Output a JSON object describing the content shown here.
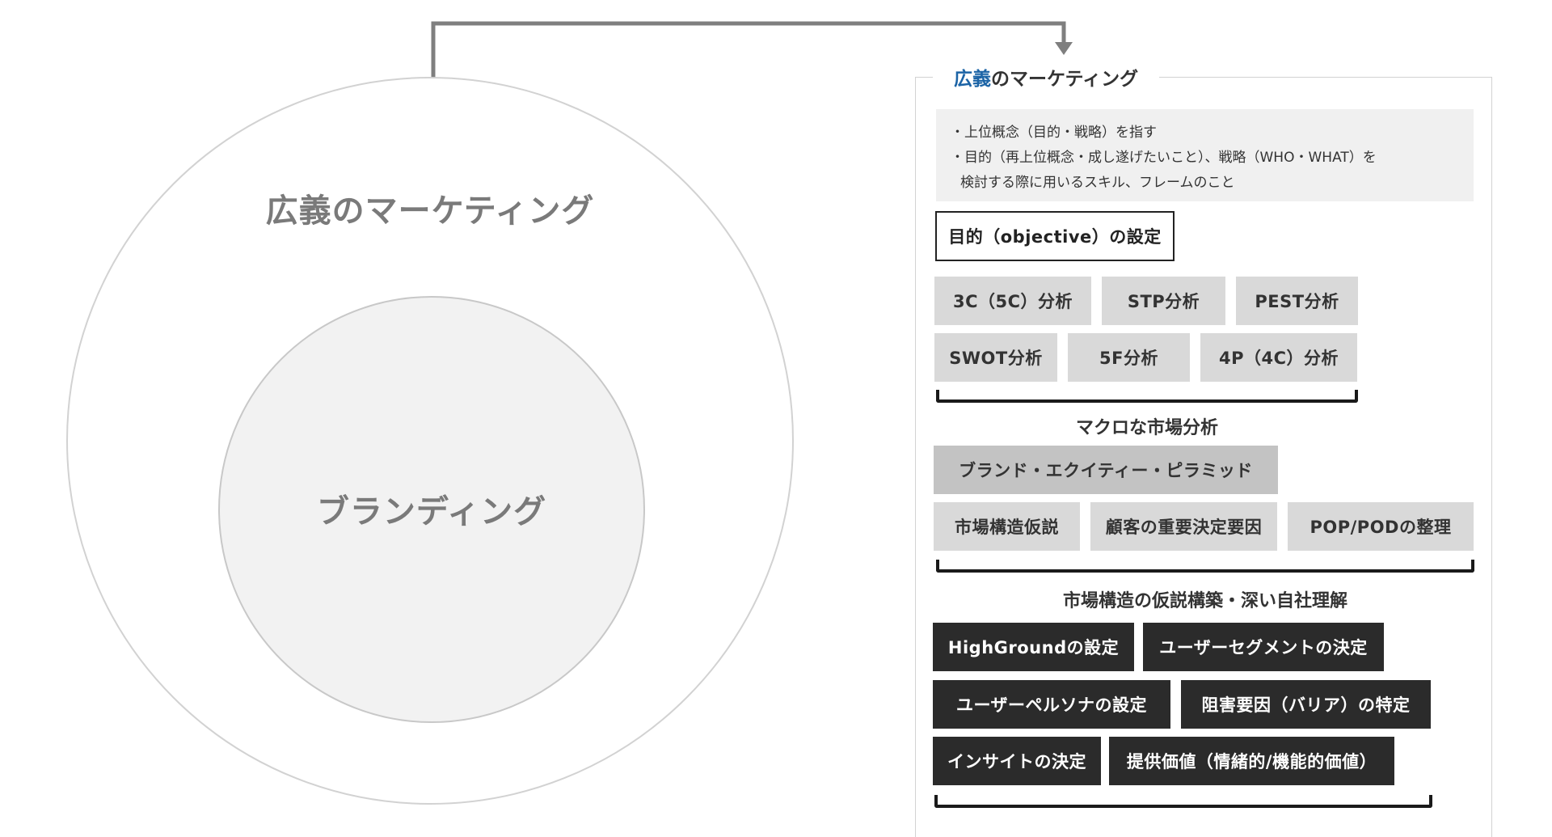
{
  "diagram": {
    "outer_label": "広義のマーケティング",
    "inner_label": "ブランディング"
  },
  "panel": {
    "title_highlight": "広義",
    "title_rest": "のマーケティング",
    "description": [
      "・上位概念（目的・戦略）を指す",
      "・目的（再上位概念・成し遂げたいこと）、戦略（WHO・WHAT）を",
      "検討する際に用いるスキル、フレームのこと"
    ],
    "objective": "目的（objective）の設定",
    "group1": {
      "items": [
        "3C（5C）分析",
        "STP分析",
        "PEST分析",
        "SWOT分析",
        "5F分析",
        "4P（4C）分析"
      ],
      "caption": "マクロな市場分析"
    },
    "group2": {
      "items": [
        "ブランド・エクイティー・ピラミッド",
        "市場構造仮説",
        "顧客の重要決定要因",
        "POP/PODの整理"
      ],
      "caption": "市場構造の仮説構築・深い自社理解"
    },
    "group3": {
      "items": [
        "HighGroundの設定",
        "ユーザーセグメントの決定",
        "ユーザーペルソナの設定",
        "阻害要因（バリア）の特定",
        "インサイトの決定",
        "提供価値（情緒的/機能的価値）"
      ]
    }
  },
  "colors": {
    "accent_blue": "#1c64a6",
    "dark_box": "#2b2b2b",
    "light_box": "#d9d9d9",
    "mid_box": "#c3c3c3",
    "connector": "#7f7f7f"
  }
}
